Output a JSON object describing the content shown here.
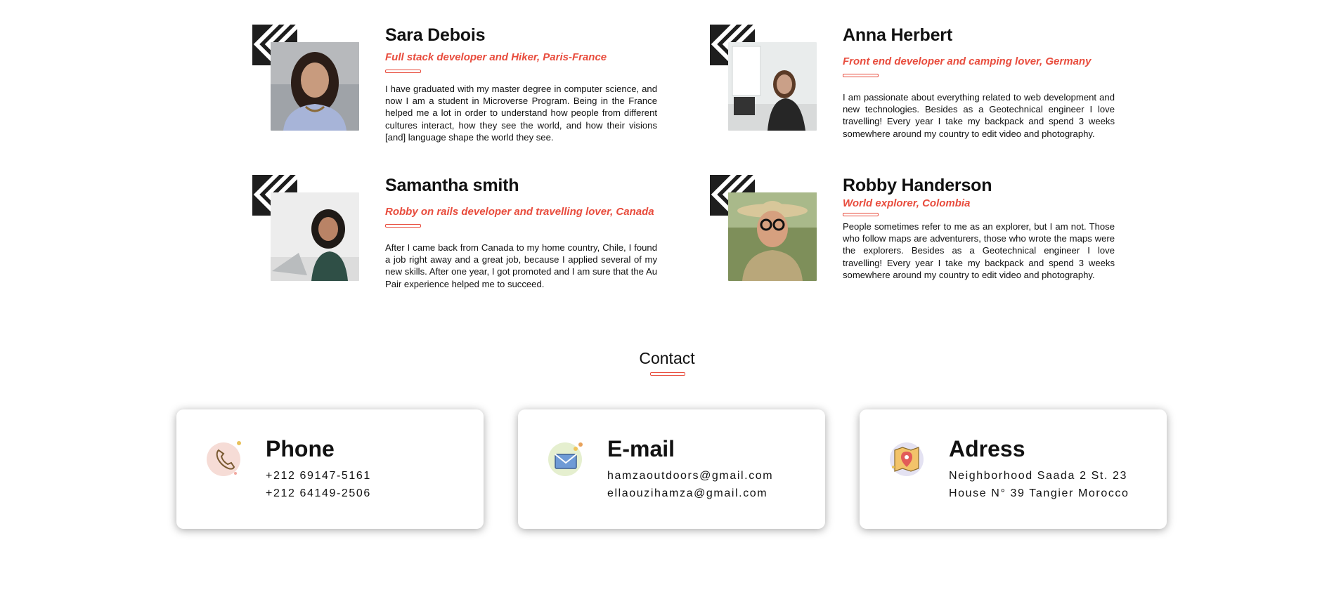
{
  "speakers": [
    {
      "name": "Sara Debois",
      "role": "Full stack developer and Hiker, Paris-France",
      "bio": "I have graduated with my master degree in computer science, and now I am a student in Microverse Program. Being in the France helped me a lot in order to understand how people from different cultures interact, how they see the world, and how their visions [and] language shape the world they see."
    },
    {
      "name": "Anna Herbert",
      "role": "Front end developer and camping lover, Germany",
      "bio": "I am passionate about everything related to web development and new technologies. Besides as a Geotechnical engineer I love travelling! Every year I take my backpack and spend 3 weeks somewhere around my country to edit video and photography."
    },
    {
      "name": "Samantha smith",
      "role": "Robby on rails developer and travelling lover, Canada",
      "bio": "After I came back from Canada to my home country, Chile, I found a job right away and a great job, because I applied several of my new skills. After one year, I got promoted and I am sure that the Au Pair experience helped me to succeed."
    },
    {
      "name": "Robby Handerson",
      "role": "World explorer, Colombia",
      "bio": "People sometimes refer to me as an explorer, but I am not. Those who follow maps are adventurers, those who wrote the maps were the explorers. Besides as a Geotechnical engineer I love travelling! Every year I take my backpack and spend 3 weeks somewhere around my country to edit video and photography."
    }
  ],
  "contact": {
    "title": "Contact",
    "cards": [
      {
        "icon": "phone-icon",
        "title": "Phone",
        "lines": [
          "+212 69147-5161",
          "+212 64149-2506"
        ]
      },
      {
        "icon": "email-icon",
        "title": "E-mail",
        "lines": [
          "hamzaoutdoors@gmail.com",
          "ellaouzihamza@gmail.com"
        ]
      },
      {
        "icon": "map-pin-icon",
        "title": "Adress",
        "lines": [
          "Neighborhood Saada 2 St. 23",
          "House N° 39 Tangier Morocco"
        ]
      }
    ]
  },
  "colors": {
    "accent": "#e84c3d",
    "text": "#111111",
    "background": "#ffffff"
  }
}
